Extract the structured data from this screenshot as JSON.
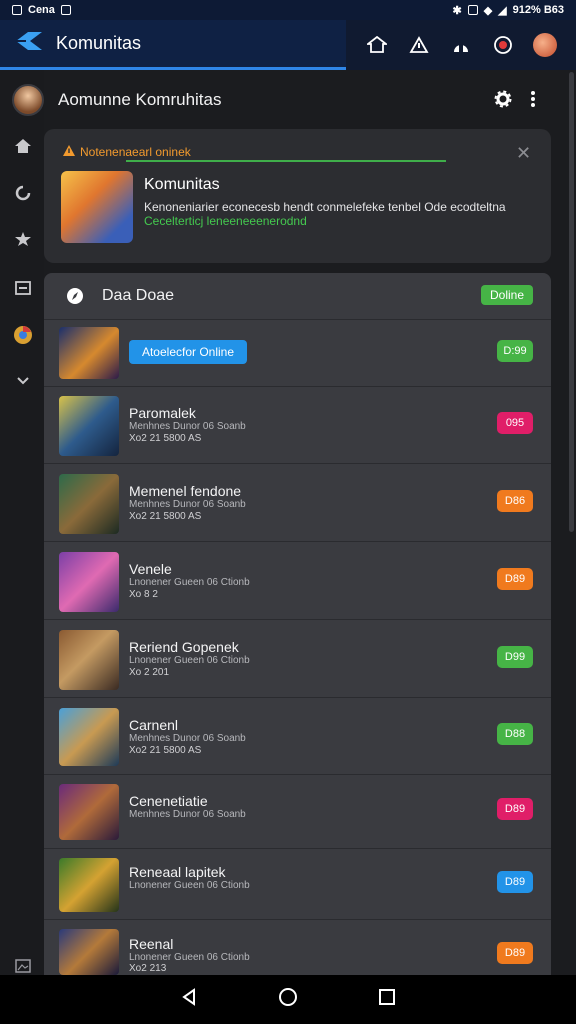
{
  "statusbar": {
    "carrier": "Cena",
    "right_text": "912% B63"
  },
  "app": {
    "title": "Komunitas"
  },
  "header": {
    "title": "Aomunne Komruhitas"
  },
  "notice": {
    "header": "Notenenaearl oninek",
    "title": "Komunitas",
    "text": "Kenoneniarier econecesb hendt conmelefeke tenbel Ode ecodteltna",
    "sub": "Cecelterticj leneeneeenerodnd"
  },
  "panel": {
    "title": "Daa Doae",
    "badge": "Doline"
  },
  "rows": [
    {
      "button": "Atoelecfor Online",
      "badge": "D:99",
      "badge_color": "#46b446"
    },
    {
      "name": "Paromalek",
      "sub": "Menhnes Dunor 06 Soanb",
      "meta": "Xo2 21 5800 AS",
      "badge": "095",
      "badge_color": "#e01e68"
    },
    {
      "name": "Memenel fendone",
      "sub": "Menhnes Dunor 06 Soanb",
      "meta": "Xo2 21 5800 AS",
      "badge": "D86",
      "badge_color": "#f07a1e"
    },
    {
      "name": "Venele",
      "sub": "Lnonener Gueen 06 Ctionb",
      "meta": "Xo 8 2",
      "badge": "D89",
      "badge_color": "#f07a1e"
    },
    {
      "name": "Reriend Gopenek",
      "sub": "Lnonener Gueen 06 Ctionb",
      "meta": "Xo 2 201",
      "badge": "D99",
      "badge_color": "#46b446"
    },
    {
      "name": "Carnenl",
      "sub": "Menhnes Dunor 06 Soanb",
      "meta": "Xo2 21 5800 AS",
      "badge": "D88",
      "badge_color": "#46b446"
    },
    {
      "name": "Cenenetiatie",
      "sub": "Menhnes Dunor 06 Soanb",
      "meta": "",
      "badge": "D89",
      "badge_color": "#e01e68"
    },
    {
      "name": "Reneaal lapitek",
      "sub": "Lnonener Gueen 06 Ctionb",
      "meta": "",
      "badge": "D89",
      "badge_color": "#2293e8"
    },
    {
      "name": "Reenal",
      "sub": "Lnonener Gueen 06 Ctionb",
      "meta": "Xo2 213",
      "badge": "D89",
      "badge_color": "#f07a1e"
    }
  ]
}
